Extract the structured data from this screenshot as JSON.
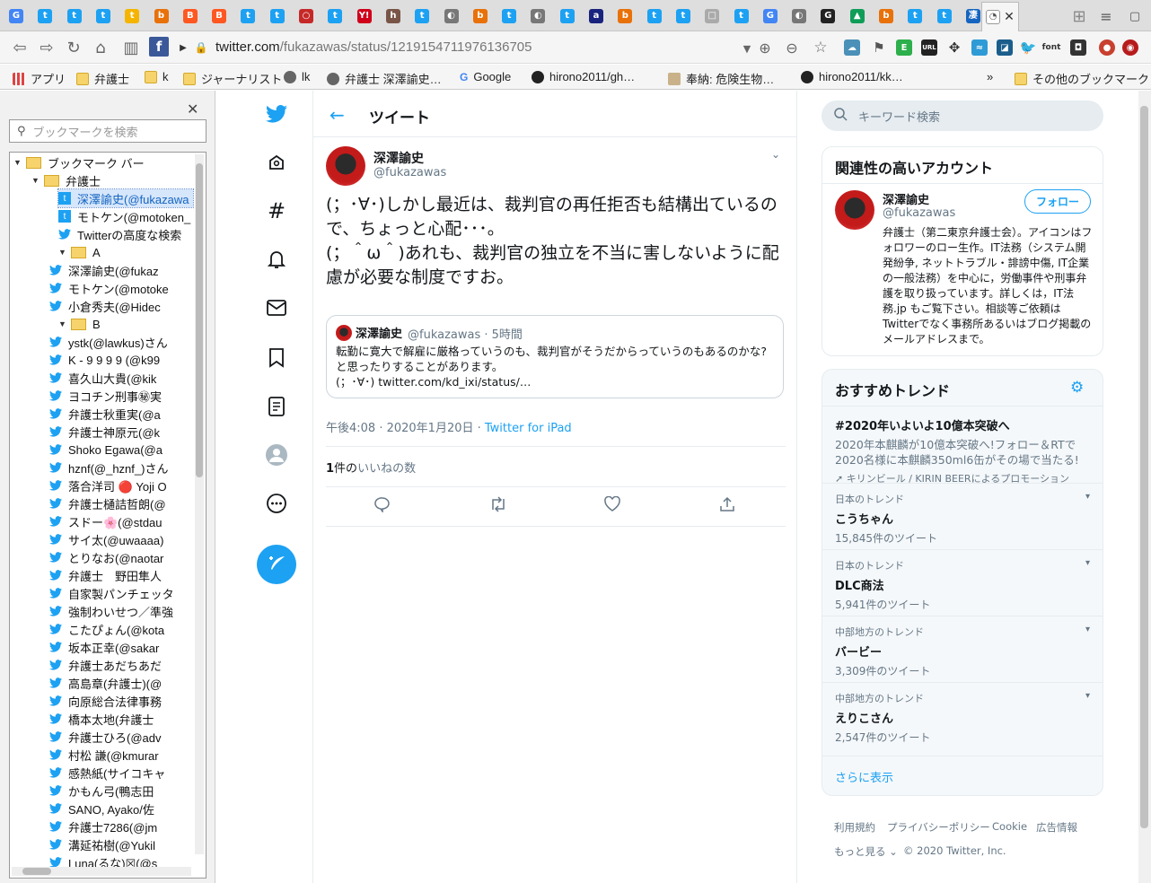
{
  "browser": {
    "tab_favicons": [
      "G",
      "t",
      "t",
      "t",
      "t",
      "b",
      "B",
      "B",
      "t",
      "t",
      "○",
      "t",
      "Y!",
      "h",
      "t",
      "◐",
      "b",
      "t",
      "◐",
      "t",
      "a",
      "b",
      "t",
      "t",
      "□",
      "t",
      "G",
      "◐",
      "G",
      "▲",
      "b",
      "t",
      "t",
      "凄",
      "b"
    ],
    "url_host": "twitter.com",
    "url_path": "/fukazawas/status/1219154711976136705",
    "bookmarks": [
      "アプリ",
      "弁護士",
      "k",
      "ジャーナリスト",
      "lk",
      "弁護士 深澤諭史…",
      "Google",
      "hirono2011/gh…",
      "奉納: 危険生物…",
      "hirono2011/kk…",
      "その他のブックマーク"
    ]
  },
  "sidebar": {
    "search_placeholder": "ブックマークを検索",
    "tree": [
      {
        "label": "ブックマーク バー",
        "type": "folder",
        "level": 0
      },
      {
        "label": "弁護士",
        "type": "folder",
        "level": 1
      },
      {
        "label": "深澤諭史(@fukazawa",
        "type": "tw",
        "level": 2,
        "selected": true
      },
      {
        "label": "モトケン(@motoken_",
        "type": "tw",
        "level": 2
      },
      {
        "label": "Twitterの高度な検索",
        "type": "tw",
        "level": 2
      },
      {
        "label": "A",
        "type": "folder",
        "level": 2
      },
      {
        "label": "深澤諭史(@fukaz",
        "type": "tw",
        "level": 3
      },
      {
        "label": "モトケン(@motoke",
        "type": "tw",
        "level": 3
      },
      {
        "label": "小倉秀夫(@Hidec",
        "type": "tw",
        "level": 3
      },
      {
        "label": "B",
        "type": "folder",
        "level": 2
      },
      {
        "label": "ystk(@lawkus)さん",
        "type": "tw",
        "level": 3
      },
      {
        "label": "K - 9 9 9 9 (@k99",
        "type": "tw",
        "level": 3
      },
      {
        "label": "喜久山大貴(@kik",
        "type": "tw",
        "level": 3
      },
      {
        "label": "ヨコチン刑事㊙実",
        "type": "tw",
        "level": 3
      },
      {
        "label": "弁護士秋重実(@a",
        "type": "tw",
        "level": 3
      },
      {
        "label": "弁護士神原元(@k",
        "type": "tw",
        "level": 3
      },
      {
        "label": "Shoko Egawa(@a",
        "type": "tw",
        "level": 3
      },
      {
        "label": "hznf(@_hznf_)さん",
        "type": "tw",
        "level": 3
      },
      {
        "label": "落合洋司 🔴 Yoji O",
        "type": "tw",
        "level": 3
      },
      {
        "label": "弁護士樋詰哲朗(@",
        "type": "tw",
        "level": 3
      },
      {
        "label": "スドー🌸(@stdau",
        "type": "tw",
        "level": 3
      },
      {
        "label": "サイ太(@uwaaaa)",
        "type": "tw",
        "level": 3
      },
      {
        "label": "とりなお(@naotar",
        "type": "tw",
        "level": 3
      },
      {
        "label": "弁護士　野田隼人",
        "type": "tw",
        "level": 3
      },
      {
        "label": "自家製パンチェッタ",
        "type": "tw",
        "level": 3
      },
      {
        "label": "強制わいせつ／準強",
        "type": "tw",
        "level": 3
      },
      {
        "label": "こたぴょん(@kota",
        "type": "tw",
        "level": 3
      },
      {
        "label": "坂本正幸(@sakar",
        "type": "tw",
        "level": 3
      },
      {
        "label": "弁護士あだちあだ",
        "type": "tw",
        "level": 3
      },
      {
        "label": "高島章(弁護士)(@",
        "type": "tw",
        "level": 3
      },
      {
        "label": "向原総合法律事務",
        "type": "tw",
        "level": 3
      },
      {
        "label": "橋本太地(弁護士",
        "type": "tw",
        "level": 3
      },
      {
        "label": "弁護士ひろ(@adv",
        "type": "tw",
        "level": 3
      },
      {
        "label": "村松 謙(@kmurar",
        "type": "tw",
        "level": 3
      },
      {
        "label": "感熱紙(サイコキャ",
        "type": "tw",
        "level": 3
      },
      {
        "label": "かもん弓(鴨志田",
        "type": "tw",
        "level": 3
      },
      {
        "label": "SANO, Ayako/佐",
        "type": "tw",
        "level": 3
      },
      {
        "label": "弁護士7286(@jm",
        "type": "tw",
        "level": 3
      },
      {
        "label": "溝延祐樹(@Yukil",
        "type": "tw",
        "level": 3
      },
      {
        "label": "Luna(るな)☒(@s",
        "type": "tw",
        "level": 3
      }
    ]
  },
  "header": {
    "title": "ツイート"
  },
  "tweet": {
    "name": "深澤諭史",
    "handle": "@fukazawas",
    "text_1": "(；･∀･)しかし最近は、裁判官の再任拒否も結構出ているので、ちょっと心配･･･。",
    "text_2": "(；＾ω＾)あれも、裁判官の独立を不当に害しないように配慮が必要な制度ですお。",
    "quote_name": "深澤諭史",
    "quote_meta": "@fukazawas · 5時間",
    "quote_text_1": "転勤に寛大で解雇に厳格っていうのも、裁判官がそうだからっていうのもあるのかな?と思ったりすることがあります。",
    "quote_text_2": "(；･∀･) twitter.com/kd_ixi/status/…",
    "time": "午後4:08 · 2020年1月20日 · ",
    "source": "Twitter for iPad",
    "likes_count": "1",
    "likes_suffix": "件の",
    "likes_label": "いいねの数"
  },
  "side": {
    "search_placeholder": "キーワード検索",
    "related_title": "関連性の高いアカウント",
    "follow_label": "フォロー",
    "acct_name": "深澤諭史",
    "acct_handle": "@fukazawas",
    "acct_bio": "弁護士（第二東京弁護士会）。アイコンはフォロワーのロー生作。IT法務（システム開発紛争, ネットトラブル・誹謗中傷, IT企業の一般法務）を中心に，労働事件や刑事弁護を取り扱っています。詳しくは，IT法務.jp もご覧下さい。相談等ご依頼はTwitterでなく事務所あるいはブログ掲載のメールアドレスまで。",
    "trends_title": "おすすめトレンド",
    "promo_title": "#2020年いよいよ10億本突破へ",
    "promo_desc": "2020年本麒麟が10億本突破へ!フォロー＆RTで2020名様に本麒麟350ml6缶がその場で当たる!",
    "promo_by": "キリンビール / KIRIN BEERによるプロモーション",
    "trends": [
      {
        "loc": "日本のトレンド",
        "title": "こうちゃん",
        "count": "15,845件のツイート"
      },
      {
        "loc": "日本のトレンド",
        "title": "DLC商法",
        "count": "5,941件のツイート"
      },
      {
        "loc": "中部地方のトレンド",
        "title": "バービー",
        "count": "3,309件のツイート"
      },
      {
        "loc": "中部地方のトレンド",
        "title": "えりこさん",
        "count": "2,547件のツイート"
      }
    ],
    "show_more": "さらに表示",
    "footer_links": [
      "利用規約",
      "プライバシーポリシー",
      "Cookie",
      "広告情報"
    ],
    "footer_more": "もっと見る ⌄",
    "copyright": "© 2020 Twitter, Inc."
  },
  "colors": {
    "twitter_blue": "#1da1f2",
    "muted": "#657786"
  }
}
